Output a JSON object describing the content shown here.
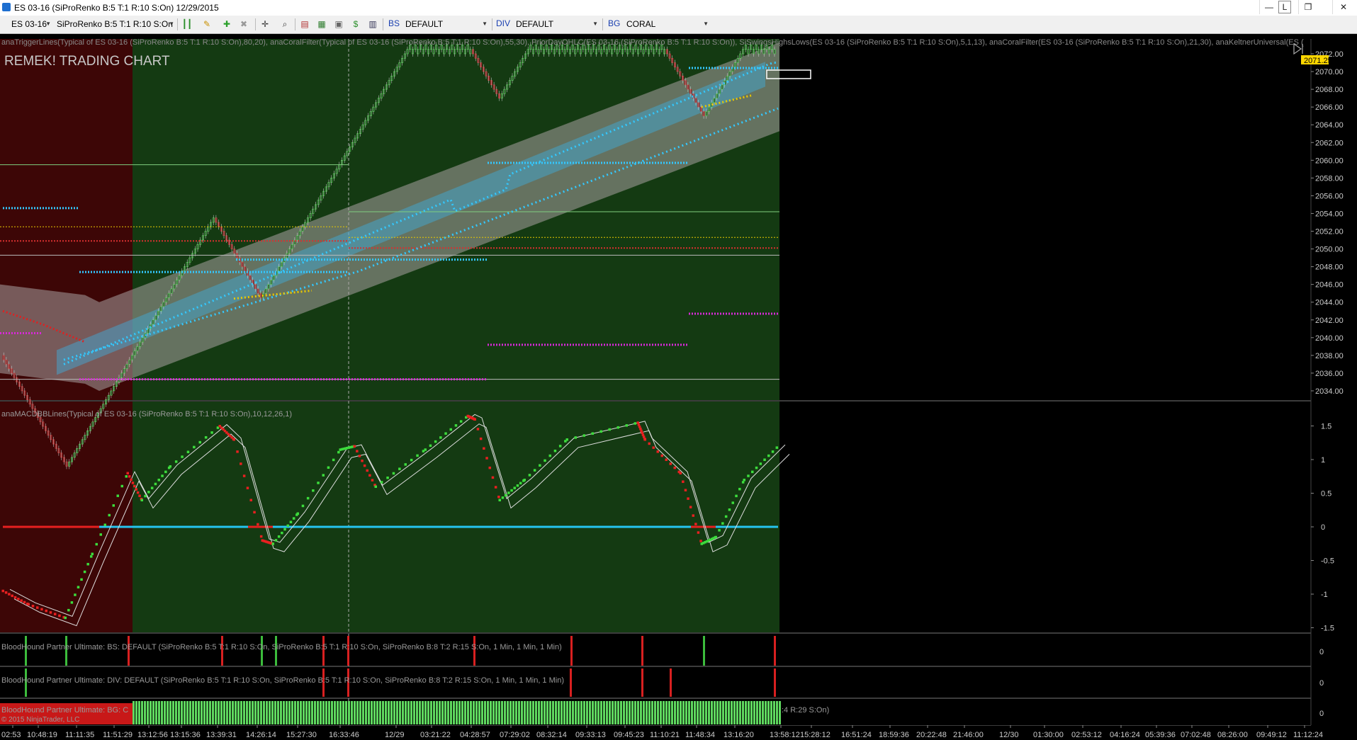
{
  "window": {
    "title": "ES 03-16 (SiProRenko B:5 T:1 R:10 S:On)  12/29/2015",
    "buttons": {
      "minimize": "—",
      "link": "L",
      "restore": "❐",
      "close": "✕"
    }
  },
  "toolbar": {
    "instrument": "ES 03-16",
    "bar_type": "SiProRenko B:5 T:1 R:10 S:On",
    "bs_label": "BS",
    "bs_value": "DEFAULT",
    "div_label": "DIV",
    "div_value": "DEFAULT",
    "bg_label": "BG",
    "bg_value": "CORAL"
  },
  "price_panel": {
    "indicator_legend": "anaTriggerLines(Typical of ES 03-16 (SiProRenko B:5 T:1 R:10 S:On),80,20), anaCoralFilter(Typical of ES 03-16 (SiProRenko B:5 T:1 R:10 S:On),55,30), PriorDayOHLC(ES 03-16 (SiProRenko B:5 T:1 R:10 S:On)), SiSwingsHighsLows(ES 03-16 (SiProRenko B:5 T:1 R:10 S:On),5,1,13), anaCoralFilter(ES 03-16 (SiProRenko B:5 T:1 R:10 S:On),21,30), anaKeltnerUniversal(ES (",
    "chart_title": "REMEK! TRADING CHART",
    "last_price": "2071.25",
    "y_ticks": [
      "2072.00",
      "2070.00",
      "2068.00",
      "2066.00",
      "2064.00",
      "2062.00",
      "2060.00",
      "2058.00",
      "2056.00",
      "2054.00",
      "2052.00",
      "2050.00",
      "2048.00",
      "2046.00",
      "2044.00",
      "2042.00",
      "2040.00",
      "2038.00",
      "2036.00",
      "2034.00"
    ]
  },
  "macd_panel": {
    "legend": "anaMACDBBLines(Typical of ES 03-16 (SiProRenko B:5 T:1 R:10 S:On),10,12,26,1)",
    "y_ticks": [
      "1.5",
      "1",
      "0.5",
      "0",
      "-0.5",
      "-1",
      "-1.5"
    ]
  },
  "bs_panel": {
    "legend": "BloodHound Partner Ultimate: BS: DEFAULT (SiProRenko B:5 T:1 R:10 S:On, SiProRenko B:5 T:1 R:10 S:On, SiProRenko B:8 T:2 R:15 S:On, 1 Min, 1 Min, 1 Min)",
    "y_tick": "0"
  },
  "div_panel": {
    "legend": "BloodHound Partner Ultimate: DIV: DEFAULT (SiProRenko B:5 T:1 R:10 S:On, SiProRenko B:5 T:1 R:10 S:On, SiProRenko B:8 T:2 R:15 S:On, 1 Min, 1 Min, 1 Min)",
    "y_tick": "0"
  },
  "bg_panel": {
    "legend_left": "BloodHound Partner Ultimate: BG: C",
    "legend_right": ":4 R:29 S:On)",
    "copyright": "© 2015 NinjaTrader, LLC",
    "y_tick": "0"
  },
  "x_axis": [
    "02:53",
    "10:48:19",
    "11:11:35",
    "11:51:29",
    "13:12:56",
    "13:15:36",
    "13:39:31",
    "14:26:14",
    "15:27:30",
    "16:33:46",
    "12/29",
    "03:21:22",
    "04:28:57",
    "07:29:02",
    "08:32:14",
    "09:33:13",
    "09:45:23",
    "11:10:21",
    "11:48:34",
    "13:16:20",
    "13:58:12",
    "15:28:12",
    "16:51:24",
    "18:59:36",
    "20:22:48",
    "21:46:00",
    "12/30",
    "01:30:00",
    "02:53:12",
    "04:16:24",
    "05:39:36",
    "07:02:48",
    "08:26:00",
    "09:49:12",
    "11:12:24"
  ],
  "colors": {
    "bg_red": "#3d0606",
    "bg_green": "#143a12",
    "accent_cyan": "#33c8ff",
    "macd_up": "#3cdc3c",
    "macd_down": "#e82020",
    "zero_red": "#e62020",
    "zero_cyan": "#25c4f0",
    "level_magenta": "#d829d8",
    "level_yellow": "#e8c800",
    "price_tag": "#ffd700"
  }
}
